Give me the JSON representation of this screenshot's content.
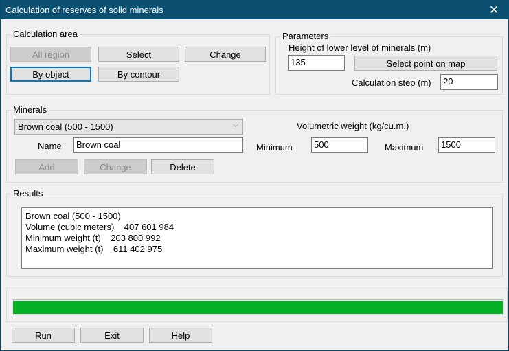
{
  "window": {
    "title": "Calculation of reserves of solid minerals",
    "close_icon": "close-icon"
  },
  "calc_area": {
    "legend": "Calculation area",
    "buttons": {
      "all_region": "All region",
      "select": "Select",
      "change": "Change",
      "by_object": "By object",
      "by_contour": "By contour"
    }
  },
  "parameters": {
    "legend": "Parameters",
    "height_label": "Height of lower level of minerals (m)",
    "height_value": "135",
    "select_point": "Select point on map",
    "step_label": "Calculation step (m)",
    "step_value": "20"
  },
  "minerals": {
    "legend": "Minerals",
    "selected": "Brown coal (500 - 1500)",
    "name_label": "Name",
    "name_value": "Brown coal",
    "vol_weight_label": "Volumetric weight (kg/cu.m.)",
    "min_label": "Minimum",
    "min_value": "500",
    "max_label": "Maximum",
    "max_value": "1500",
    "buttons": {
      "add": "Add",
      "change": "Change",
      "delete": "Delete"
    }
  },
  "results": {
    "legend": "Results",
    "lines": [
      "Brown coal (500 - 1500)",
      "Volume (cubic meters)    407 601 984",
      "Minimum weight (t)    203 800 992",
      "Maximum weight (t)    611 402 975"
    ]
  },
  "progress": {
    "percent": 100,
    "color": "#06b025"
  },
  "footer": {
    "run": "Run",
    "exit": "Exit",
    "help": "Help"
  }
}
